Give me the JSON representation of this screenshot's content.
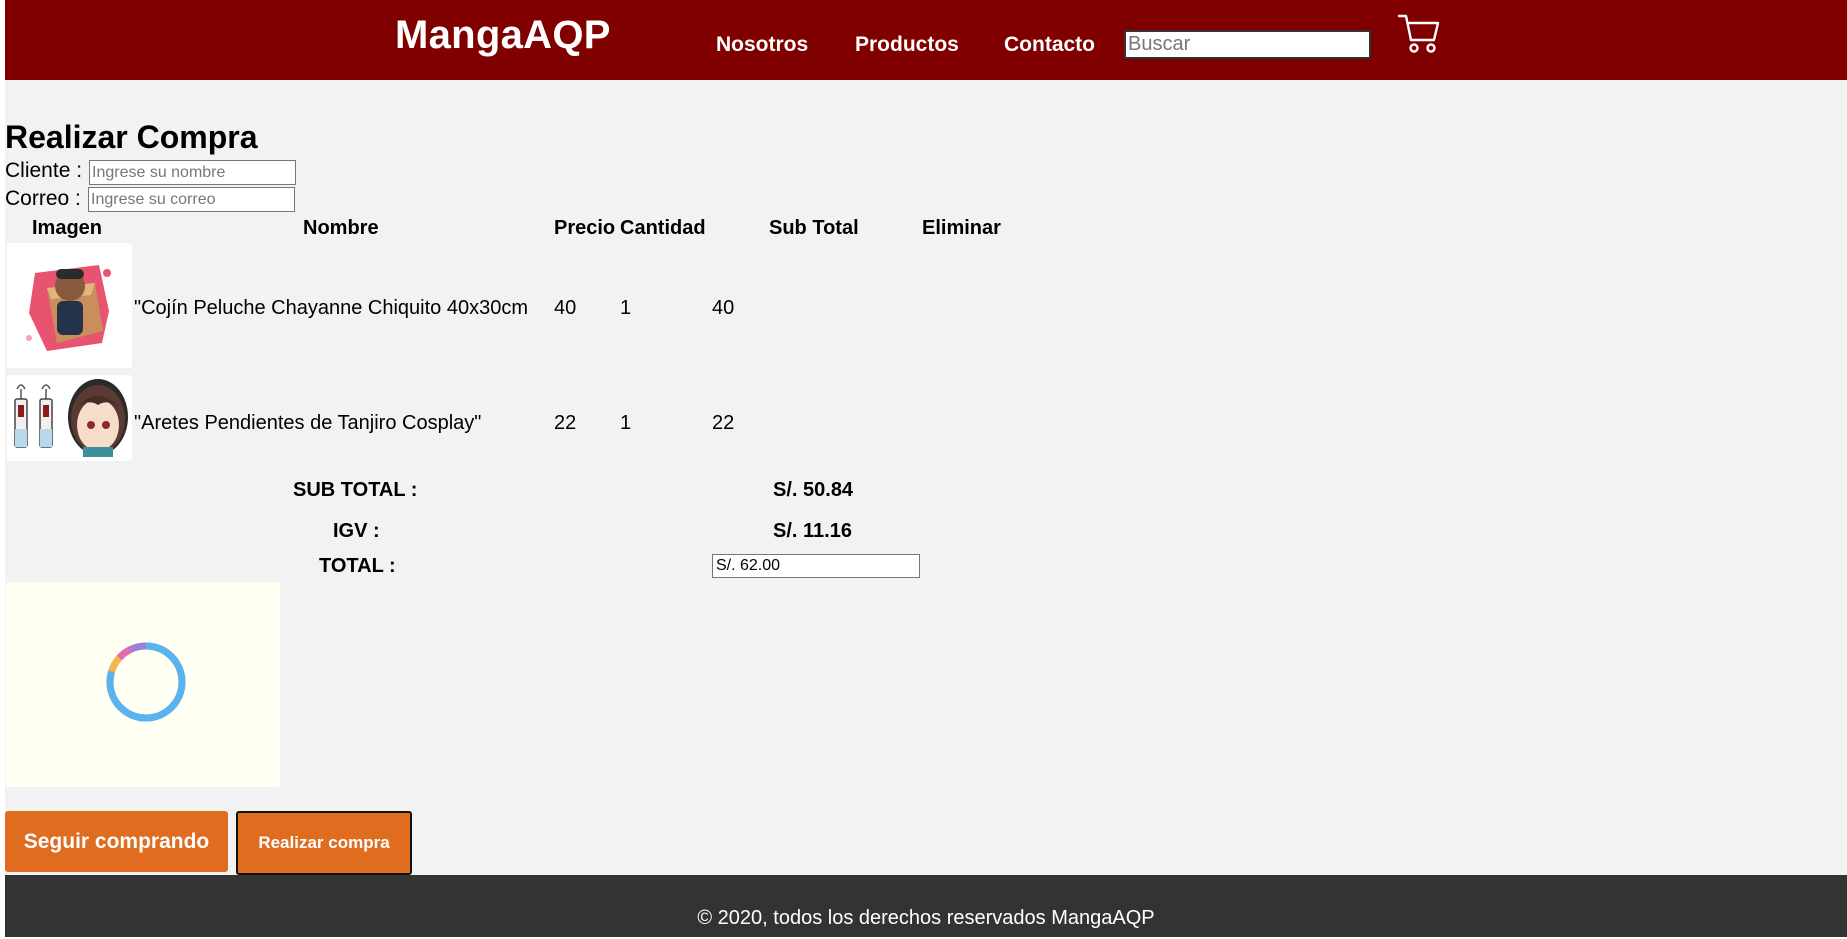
{
  "header": {
    "brand": "MangaAQP",
    "nav": [
      {
        "label": "Nosotros"
      },
      {
        "label": "Productos"
      },
      {
        "label": "Contacto"
      }
    ],
    "search_placeholder": "Buscar",
    "cart_icon": "shopping-cart-icon"
  },
  "page": {
    "title": "Realizar Compra",
    "client_label": "Cliente :",
    "client_placeholder": "Ingrese su nombre",
    "email_label": "Correo :",
    "email_placeholder": "Ingrese su correo"
  },
  "table": {
    "headers": [
      "Imagen",
      "Nombre",
      "Precio",
      "Cantidad",
      "Sub Total",
      "Eliminar"
    ],
    "rows": [
      {
        "name": "\"Cojín Peluche Chayanne Chiquito 40x30cm",
        "price": "40",
        "quantity": "1",
        "subtotal": "40",
        "image": "cushion-product-image"
      },
      {
        "name": "\"Aretes Pendientes de Tanjiro Cosplay\"",
        "price": "22",
        "quantity": "1",
        "subtotal": "22",
        "image": "earrings-product-image"
      }
    ]
  },
  "summary": {
    "subtotal_label": "SUB TOTAL :",
    "subtotal_value": "S/. 50.84",
    "igv_label": "IGV :",
    "igv_value": "S/. 11.16",
    "total_label": "TOTAL :",
    "total_value": "S/. 62.00"
  },
  "buttons": {
    "continue": "Seguir comprando",
    "buy": "Realizar compra"
  },
  "footer": {
    "text": "© 2020, todos los derechos reservados MangaAQP"
  },
  "colors": {
    "header_bg": "#800000",
    "button_bg": "#e06c1f",
    "footer_bg": "#333333",
    "page_bg": "#f2f2f2"
  }
}
